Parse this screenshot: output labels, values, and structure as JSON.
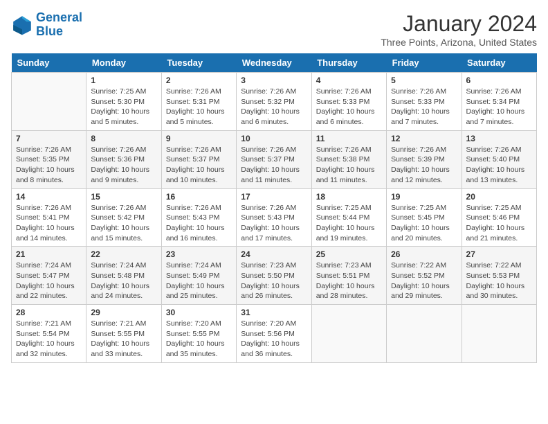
{
  "header": {
    "logo_line1": "General",
    "logo_line2": "Blue",
    "month": "January 2024",
    "location": "Three Points, Arizona, United States"
  },
  "weekdays": [
    "Sunday",
    "Monday",
    "Tuesday",
    "Wednesday",
    "Thursday",
    "Friday",
    "Saturday"
  ],
  "weeks": [
    [
      {
        "day": "",
        "info": ""
      },
      {
        "day": "1",
        "info": "Sunrise: 7:25 AM\nSunset: 5:30 PM\nDaylight: 10 hours\nand 5 minutes."
      },
      {
        "day": "2",
        "info": "Sunrise: 7:26 AM\nSunset: 5:31 PM\nDaylight: 10 hours\nand 5 minutes."
      },
      {
        "day": "3",
        "info": "Sunrise: 7:26 AM\nSunset: 5:32 PM\nDaylight: 10 hours\nand 6 minutes."
      },
      {
        "day": "4",
        "info": "Sunrise: 7:26 AM\nSunset: 5:33 PM\nDaylight: 10 hours\nand 6 minutes."
      },
      {
        "day": "5",
        "info": "Sunrise: 7:26 AM\nSunset: 5:33 PM\nDaylight: 10 hours\nand 7 minutes."
      },
      {
        "day": "6",
        "info": "Sunrise: 7:26 AM\nSunset: 5:34 PM\nDaylight: 10 hours\nand 7 minutes."
      }
    ],
    [
      {
        "day": "7",
        "info": "Sunrise: 7:26 AM\nSunset: 5:35 PM\nDaylight: 10 hours\nand 8 minutes."
      },
      {
        "day": "8",
        "info": "Sunrise: 7:26 AM\nSunset: 5:36 PM\nDaylight: 10 hours\nand 9 minutes."
      },
      {
        "day": "9",
        "info": "Sunrise: 7:26 AM\nSunset: 5:37 PM\nDaylight: 10 hours\nand 10 minutes."
      },
      {
        "day": "10",
        "info": "Sunrise: 7:26 AM\nSunset: 5:37 PM\nDaylight: 10 hours\nand 11 minutes."
      },
      {
        "day": "11",
        "info": "Sunrise: 7:26 AM\nSunset: 5:38 PM\nDaylight: 10 hours\nand 11 minutes."
      },
      {
        "day": "12",
        "info": "Sunrise: 7:26 AM\nSunset: 5:39 PM\nDaylight: 10 hours\nand 12 minutes."
      },
      {
        "day": "13",
        "info": "Sunrise: 7:26 AM\nSunset: 5:40 PM\nDaylight: 10 hours\nand 13 minutes."
      }
    ],
    [
      {
        "day": "14",
        "info": "Sunrise: 7:26 AM\nSunset: 5:41 PM\nDaylight: 10 hours\nand 14 minutes."
      },
      {
        "day": "15",
        "info": "Sunrise: 7:26 AM\nSunset: 5:42 PM\nDaylight: 10 hours\nand 15 minutes."
      },
      {
        "day": "16",
        "info": "Sunrise: 7:26 AM\nSunset: 5:43 PM\nDaylight: 10 hours\nand 16 minutes."
      },
      {
        "day": "17",
        "info": "Sunrise: 7:26 AM\nSunset: 5:43 PM\nDaylight: 10 hours\nand 17 minutes."
      },
      {
        "day": "18",
        "info": "Sunrise: 7:25 AM\nSunset: 5:44 PM\nDaylight: 10 hours\nand 19 minutes."
      },
      {
        "day": "19",
        "info": "Sunrise: 7:25 AM\nSunset: 5:45 PM\nDaylight: 10 hours\nand 20 minutes."
      },
      {
        "day": "20",
        "info": "Sunrise: 7:25 AM\nSunset: 5:46 PM\nDaylight: 10 hours\nand 21 minutes."
      }
    ],
    [
      {
        "day": "21",
        "info": "Sunrise: 7:24 AM\nSunset: 5:47 PM\nDaylight: 10 hours\nand 22 minutes."
      },
      {
        "day": "22",
        "info": "Sunrise: 7:24 AM\nSunset: 5:48 PM\nDaylight: 10 hours\nand 24 minutes."
      },
      {
        "day": "23",
        "info": "Sunrise: 7:24 AM\nSunset: 5:49 PM\nDaylight: 10 hours\nand 25 minutes."
      },
      {
        "day": "24",
        "info": "Sunrise: 7:23 AM\nSunset: 5:50 PM\nDaylight: 10 hours\nand 26 minutes."
      },
      {
        "day": "25",
        "info": "Sunrise: 7:23 AM\nSunset: 5:51 PM\nDaylight: 10 hours\nand 28 minutes."
      },
      {
        "day": "26",
        "info": "Sunrise: 7:22 AM\nSunset: 5:52 PM\nDaylight: 10 hours\nand 29 minutes."
      },
      {
        "day": "27",
        "info": "Sunrise: 7:22 AM\nSunset: 5:53 PM\nDaylight: 10 hours\nand 30 minutes."
      }
    ],
    [
      {
        "day": "28",
        "info": "Sunrise: 7:21 AM\nSunset: 5:54 PM\nDaylight: 10 hours\nand 32 minutes."
      },
      {
        "day": "29",
        "info": "Sunrise: 7:21 AM\nSunset: 5:55 PM\nDaylight: 10 hours\nand 33 minutes."
      },
      {
        "day": "30",
        "info": "Sunrise: 7:20 AM\nSunset: 5:55 PM\nDaylight: 10 hours\nand 35 minutes."
      },
      {
        "day": "31",
        "info": "Sunrise: 7:20 AM\nSunset: 5:56 PM\nDaylight: 10 hours\nand 36 minutes."
      },
      {
        "day": "",
        "info": ""
      },
      {
        "day": "",
        "info": ""
      },
      {
        "day": "",
        "info": ""
      }
    ]
  ]
}
